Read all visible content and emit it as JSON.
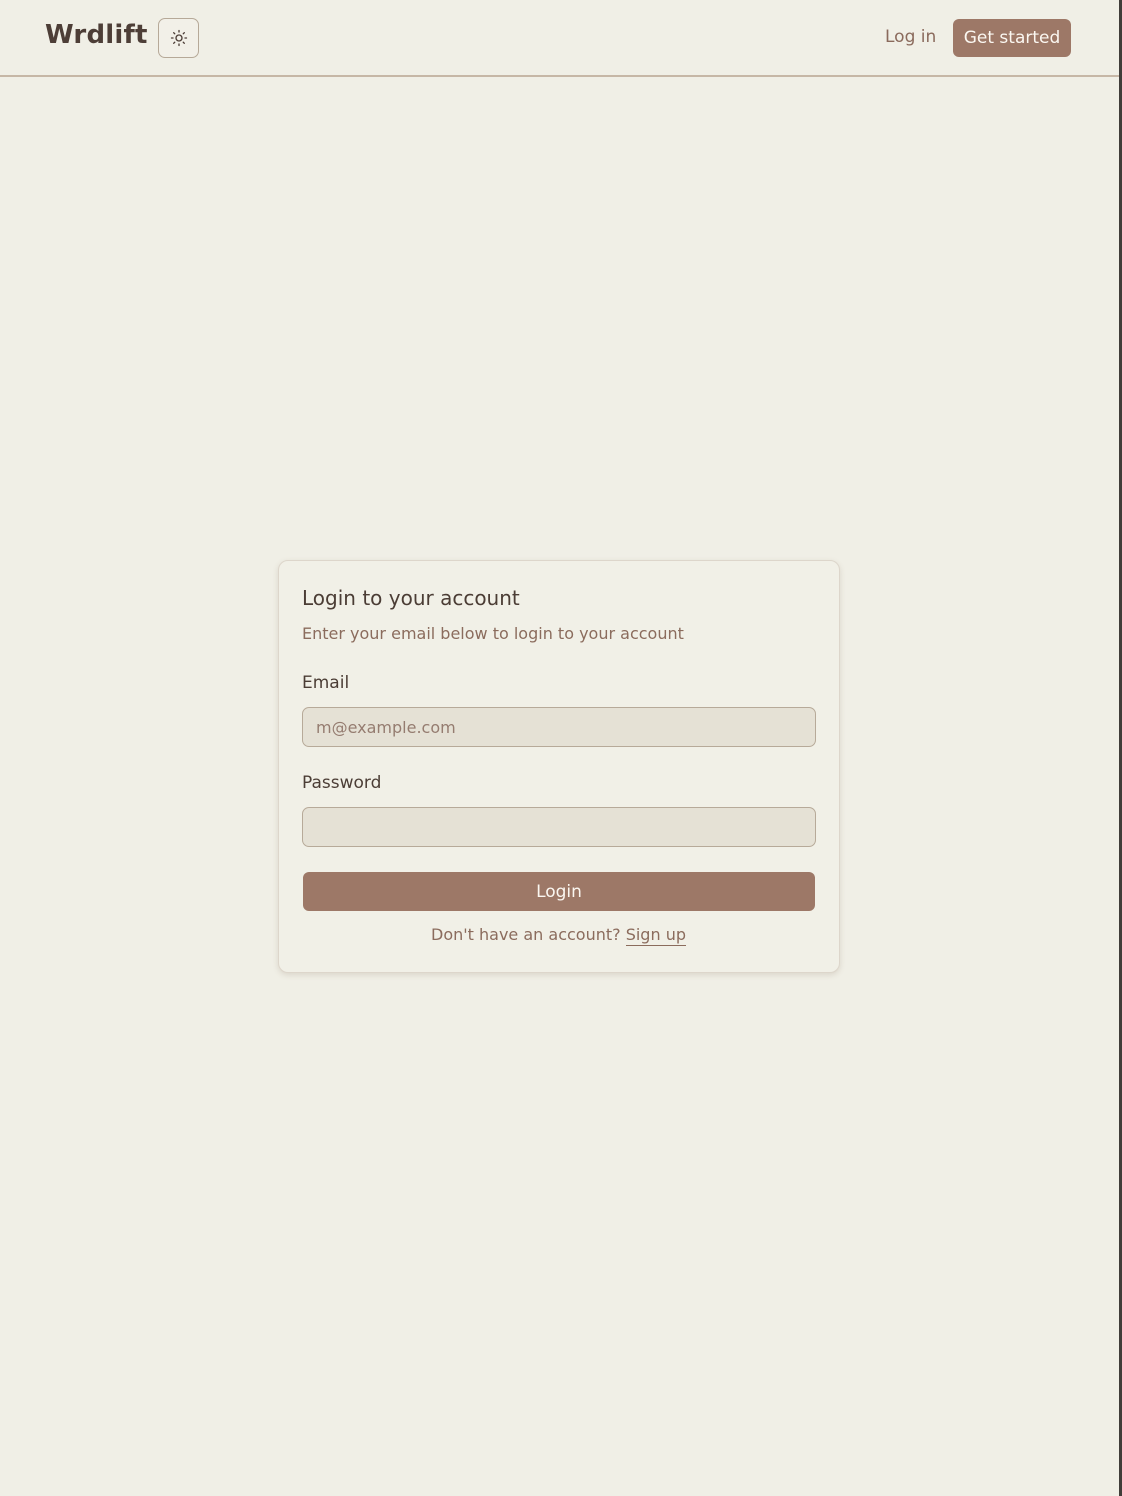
{
  "header": {
    "brand": "Wrdlift",
    "theme_toggle_icon": "sun-icon",
    "login_link": "Log in",
    "get_started_button": "Get started"
  },
  "login_card": {
    "title": "Login to your account",
    "description": "Enter your email below to login to your account",
    "email_label": "Email",
    "email_placeholder": "m@example.com",
    "email_value": "",
    "password_label": "Password",
    "password_value": "",
    "login_button": "Login",
    "signup_prompt": "Don't have an account?",
    "signup_link": "Sign up"
  },
  "colors": {
    "background": "#f0efe6",
    "accent": "#9d7867",
    "text_primary": "#4d3e37",
    "text_muted": "#8b6c5d",
    "input_background": "#e5e1d5",
    "border": "#c6b7a6"
  }
}
